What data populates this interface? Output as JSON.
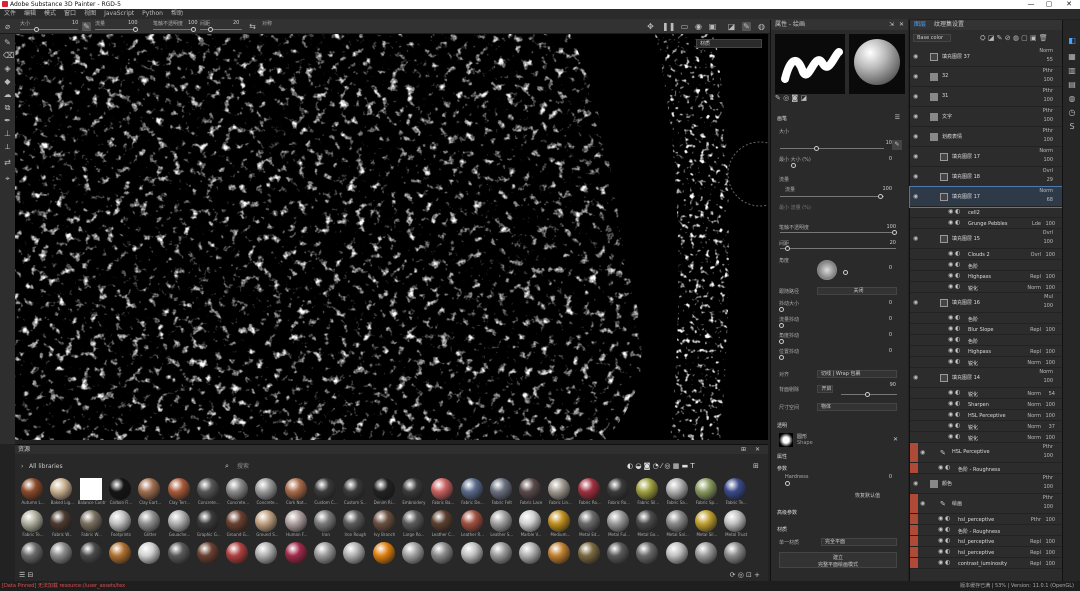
{
  "window": {
    "title": "Adobe Substance 3D Painter - RGD-5",
    "min": "—",
    "max": "▢",
    "close": "✕"
  },
  "menu": [
    "文件",
    "编辑",
    "模式",
    "窗口",
    "视图",
    "JavaScript",
    "Python",
    "帮助"
  ],
  "toolbar": {
    "size_label": "大小",
    "size_value": "10",
    "flow_label": "流量",
    "flow_value": "100",
    "stroke_opacity_label": "笔触不透明度",
    "stroke_opacity_value": "100",
    "spacing_label": "间距",
    "spacing_value": "20",
    "symmetry_label": "对称"
  },
  "viewport": {
    "mode_dropdown": "材质",
    "accent": "#000000"
  },
  "shelf": {
    "title": "资源",
    "library": "All libraries",
    "search_placeholder": "搜索",
    "row1": [
      {
        "name": "Autumn L...",
        "color": "#8a4a2a"
      },
      {
        "name": "Baked Lig...",
        "color": "#c8b090"
      },
      {
        "name": "Balance Contrast",
        "color": "#ffffff"
      },
      {
        "name": "Carbon Fi...",
        "color": "#141414"
      },
      {
        "name": "Clay Eart...",
        "color": "#a06e50"
      },
      {
        "name": "Clay Terr...",
        "color": "#a85a3a"
      },
      {
        "name": "Concrete...",
        "color": "#555555"
      },
      {
        "name": "Concrete...",
        "color": "#8a8a8a"
      },
      {
        "name": "Concrete...",
        "color": "#9a9a9a"
      },
      {
        "name": "Cork Nat...",
        "color": "#a86a4a"
      },
      {
        "name": "Custom C...",
        "color": "#3a3a3a"
      },
      {
        "name": "Custom S...",
        "color": "#3a3a3a"
      },
      {
        "name": "Denim Ri...",
        "color": "#222222"
      },
      {
        "name": "Embroidery",
        "color": "#3a3a3a"
      },
      {
        "name": "Fabric Ba...",
        "color": "#c86060"
      },
      {
        "name": "Fabric De...",
        "color": "#5a6a8a"
      },
      {
        "name": "Fabric Felt",
        "color": "#6a7080"
      },
      {
        "name": "Fabric Lace",
        "color": "#5a4a4a"
      },
      {
        "name": "Fabric Lin...",
        "color": "#a09a90"
      },
      {
        "name": "Fabric Ro...",
        "color": "#a03040"
      },
      {
        "name": "Fabric Ro...",
        "color": "#3a3a3a"
      },
      {
        "name": "Fabric Sil...",
        "color": "#a0a040"
      },
      {
        "name": "Fabric Sa...",
        "color": "#b0b0b0"
      },
      {
        "name": "Fabric Sp...",
        "color": "#8a9a60"
      },
      {
        "name": "Fabric Te...",
        "color": "#3a4a8a"
      }
    ],
    "row2": [
      {
        "name": "Fabric Te...",
        "color": "#b0b0a0"
      },
      {
        "name": "Fabric W...",
        "color": "#4a3a30"
      },
      {
        "name": "Fabric W...",
        "color": "#7a7060"
      },
      {
        "name": "Footprints",
        "color": "#c0c0c0"
      },
      {
        "name": "Glitter",
        "color": "#909090"
      },
      {
        "name": "Gouache...",
        "color": "#b0b0b0"
      },
      {
        "name": "Graphic G...",
        "color": "#3a3a3a"
      },
      {
        "name": "Ground G...",
        "color": "#6a4030"
      },
      {
        "name": "Ground S...",
        "color": "#c0a080"
      },
      {
        "name": "Human F...",
        "color": "#b0a0a0"
      },
      {
        "name": "Iron",
        "color": "#7a7a7a"
      },
      {
        "name": "Iron Rough",
        "color": "#5a5a5a"
      },
      {
        "name": "Ivy Branch",
        "color": "#6a5040"
      },
      {
        "name": "Large Ro...",
        "color": "#5a5a5a"
      },
      {
        "name": "Leather C...",
        "color": "#5a4030"
      },
      {
        "name": "Leather R...",
        "color": "#a05040"
      },
      {
        "name": "Leather S...",
        "color": "#a0a0a0"
      },
      {
        "name": "Marble V...",
        "color": "#d0d0d0"
      },
      {
        "name": "Medium...",
        "color": "#c09020"
      },
      {
        "name": "Metal Ed...",
        "color": "#6a6a6a"
      },
      {
        "name": "Metal Ful...",
        "color": "#9a9a9a"
      },
      {
        "name": "Metal Go...",
        "color": "#4a4a4a"
      },
      {
        "name": "Metal Sal...",
        "color": "#8a8a8a"
      },
      {
        "name": "Metal Sil...",
        "color": "#c0a030"
      },
      {
        "name": "Metal Trust",
        "color": "#c0c0c0"
      }
    ],
    "row3": [
      {
        "name": "",
        "color": "#6a6a6a"
      },
      {
        "name": "",
        "color": "#8a8a8a"
      },
      {
        "name": "",
        "color": "#4a4a4a"
      },
      {
        "name": "",
        "color": "#b07030"
      },
      {
        "name": "",
        "color": "#d0d0d0"
      },
      {
        "name": "",
        "color": "#5a5a5a"
      },
      {
        "name": "",
        "color": "#6a4030"
      },
      {
        "name": "",
        "color": "#b04040"
      },
      {
        "name": "",
        "color": "#b0b0b0"
      },
      {
        "name": "",
        "color": "#a02a4a"
      },
      {
        "name": "",
        "color": "#9a9a9a"
      },
      {
        "name": "",
        "color": "#b0b0b0"
      },
      {
        "name": "",
        "color": "#e08010"
      },
      {
        "name": "",
        "color": "#a0a0a0"
      },
      {
        "name": "",
        "color": "#8a8a8a"
      },
      {
        "name": "",
        "color": "#c0c0c0"
      },
      {
        "name": "",
        "color": "#9a9a9a"
      },
      {
        "name": "",
        "color": "#b0b0b0"
      },
      {
        "name": "",
        "color": "#c08030"
      },
      {
        "name": "",
        "color": "#7a6a40"
      },
      {
        "name": "",
        "color": "#5a5a5a"
      },
      {
        "name": "",
        "color": "#6a6a6a"
      },
      {
        "name": "",
        "color": "#c0c0c0"
      },
      {
        "name": "",
        "color": "#9a9a9a"
      },
      {
        "name": "",
        "color": "#8a8a8a"
      }
    ]
  },
  "status": {
    "error": "[Data Pinned] 无法加载 resource://user_assets/tex",
    "version": "版本缓存已满 | 53% | Version: 11.0.1 (OpenGL)"
  },
  "props": {
    "title": "属性 - 绘画",
    "brush_section": "画笔",
    "size": "大小",
    "size_val": "10",
    "size_space": "最小 大小 (%)",
    "size_space_val": "0",
    "flow": "流量",
    "flow_val": "100",
    "flow_min": "最小 流量 (%)",
    "stroke_opacity": "笔触不透明度",
    "stroke_opacity_val": "100",
    "spacing": "间距",
    "spacing_val": "20",
    "angle": "角度",
    "angle_val": "0",
    "follow_path": "跟随路径",
    "follow_path_val": "关闭",
    "jitter_size": "抖动大小",
    "jitter_size_val": "0",
    "jitter_flow": "流量抖动",
    "jitter_flow_val": "0",
    "jitter_angle": "角度抖动",
    "jitter_angle_val": "0",
    "jitter_pos": "位置抖动",
    "jitter_pos_val": "0",
    "alignment": "对齐",
    "alignment_val": "切线 | Wrap 包裹",
    "backface": "背面剔除",
    "backface_btn": "开启",
    "backface_val": "90",
    "size_space2": "尺寸空间",
    "size_space2_val": "物体",
    "alpha": "透明",
    "alpha_name": "圆形",
    "alpha_sub": "Shape",
    "attr": "属性",
    "hardness_group": "参数",
    "hardness": "Hardness",
    "hardness_val": "0",
    "reset_btn": "恢复默认值",
    "stencil": "高级参数",
    "material": "材质",
    "material_mode": "单一材质",
    "material_val": "完全平面",
    "material_btn": "建立",
    "material_btn2": "完整平面绘画模式"
  },
  "layers": {
    "tab1": "图层",
    "tab2": "纹理集设置",
    "blend_dropdown": "Base color",
    "rows": [
      {
        "name": "填充图层 37",
        "blend": "Norm",
        "op": "55",
        "indent": 0,
        "type": "fill",
        "swatch": ""
      },
      {
        "name": "32",
        "blend": "Pthr",
        "op": "100",
        "indent": 0,
        "type": "folder",
        "swatch": ""
      },
      {
        "name": "31",
        "blend": "Pthr",
        "op": "100",
        "indent": 0,
        "type": "folder",
        "swatch": ""
      },
      {
        "name": "文字",
        "blend": "Pthr",
        "op": "100",
        "indent": 0,
        "type": "folder",
        "swatch": ""
      },
      {
        "name": "划痕表情",
        "blend": "Pthr",
        "op": "100",
        "indent": 0,
        "type": "folder",
        "swatch": ""
      },
      {
        "name": "填充图层 17",
        "blend": "Norm",
        "op": "100",
        "indent": 1,
        "type": "fill",
        "swatch": ""
      },
      {
        "name": "填充图层 18",
        "blend": "Ovrl",
        "op": "29",
        "indent": 1,
        "type": "fill",
        "swatch": ""
      },
      {
        "name": "填充图层 17",
        "blend": "Norm",
        "op": "68",
        "indent": 1,
        "type": "fill",
        "swatch": "",
        "selected": true
      },
      {
        "name": "cell2",
        "blend": "",
        "op": "",
        "indent": 2,
        "type": "sub",
        "swatch": ""
      },
      {
        "name": "Grunge Pebbles",
        "blend": "Lde",
        "op": "100",
        "indent": 2,
        "type": "sub",
        "swatch": ""
      },
      {
        "name": "填充图层 15",
        "blend": "Ovrl",
        "op": "100",
        "indent": 1,
        "type": "fill",
        "swatch": ""
      },
      {
        "name": "Clouds 2",
        "blend": "Ovrl",
        "op": "100",
        "indent": 2,
        "type": "sub",
        "swatch": ""
      },
      {
        "name": "色阶",
        "blend": "",
        "op": "",
        "indent": 2,
        "type": "sub",
        "swatch": ""
      },
      {
        "name": "Highpass",
        "blend": "Repl",
        "op": "100",
        "indent": 2,
        "type": "sub",
        "swatch": ""
      },
      {
        "name": "锐化",
        "blend": "Norm",
        "op": "100",
        "indent": 2,
        "type": "sub",
        "swatch": ""
      },
      {
        "name": "填充图层 16",
        "blend": "Mul",
        "op": "100",
        "indent": 1,
        "type": "fill",
        "swatch": ""
      },
      {
        "name": "色阶",
        "blend": "",
        "op": "",
        "indent": 2,
        "type": "sub",
        "swatch": ""
      },
      {
        "name": "Blur Slope",
        "blend": "Repl",
        "op": "100",
        "indent": 2,
        "type": "sub",
        "swatch": ""
      },
      {
        "name": "色阶",
        "blend": "",
        "op": "",
        "indent": 2,
        "type": "sub",
        "swatch": ""
      },
      {
        "name": "Highpass",
        "blend": "Repl",
        "op": "100",
        "indent": 2,
        "type": "sub",
        "swatch": ""
      },
      {
        "name": "锐化",
        "blend": "Norm",
        "op": "100",
        "indent": 2,
        "type": "sub",
        "swatch": ""
      },
      {
        "name": "填充图层 14",
        "blend": "Norm",
        "op": "100",
        "indent": 1,
        "type": "fill",
        "swatch": ""
      },
      {
        "name": "锐化",
        "blend": "Norm",
        "op": "54",
        "indent": 2,
        "type": "sub",
        "swatch": ""
      },
      {
        "name": "Sharpen",
        "blend": "Norm",
        "op": "100",
        "indent": 2,
        "type": "sub",
        "swatch": ""
      },
      {
        "name": "HSL Perceptive",
        "blend": "Norm",
        "op": "100",
        "indent": 2,
        "type": "sub",
        "swatch": ""
      },
      {
        "name": "锐化",
        "blend": "Norm",
        "op": "37",
        "indent": 2,
        "type": "sub",
        "swatch": ""
      },
      {
        "name": "锐化",
        "blend": "Norm",
        "op": "100",
        "indent": 2,
        "type": "sub",
        "swatch": ""
      },
      {
        "name": "HSL Perceptive",
        "blend": "Pthr",
        "op": "100",
        "indent": 1,
        "type": "paint",
        "swatch": "#b04a38"
      },
      {
        "name": "色阶 - Roughness",
        "blend": "",
        "op": "",
        "indent": 1,
        "type": "sub",
        "swatch": "#b04a38"
      },
      {
        "name": "颜色",
        "blend": "Pthr",
        "op": "100",
        "indent": 0,
        "type": "folder",
        "swatch": ""
      },
      {
        "name": "绘画",
        "blend": "Pthr",
        "op": "100",
        "indent": 1,
        "type": "paint",
        "swatch": "#b04a38"
      },
      {
        "name": "hsl_perceptive",
        "blend": "Pthr",
        "op": "100",
        "indent": 1,
        "type": "sub",
        "swatch": "#b04a38"
      },
      {
        "name": "色阶 - Roughness",
        "blend": "",
        "op": "",
        "indent": 1,
        "type": "sub",
        "swatch": "#b04a38"
      },
      {
        "name": "hsl_perceptive",
        "blend": "Repl",
        "op": "100",
        "indent": 1,
        "type": "sub",
        "swatch": "#b04a38"
      },
      {
        "name": "hsl_perceptive",
        "blend": "Repl",
        "op": "100",
        "indent": 1,
        "type": "sub",
        "swatch": "#b04a38"
      },
      {
        "name": "contrast_luminosity",
        "blend": "Repl",
        "op": "100",
        "indent": 1,
        "type": "sub",
        "swatch": "#b04a38"
      },
      {
        "name": "颜色",
        "blend": "Pthr",
        "op": "100",
        "indent": 0,
        "type": "folder",
        "swatch": ""
      }
    ]
  }
}
